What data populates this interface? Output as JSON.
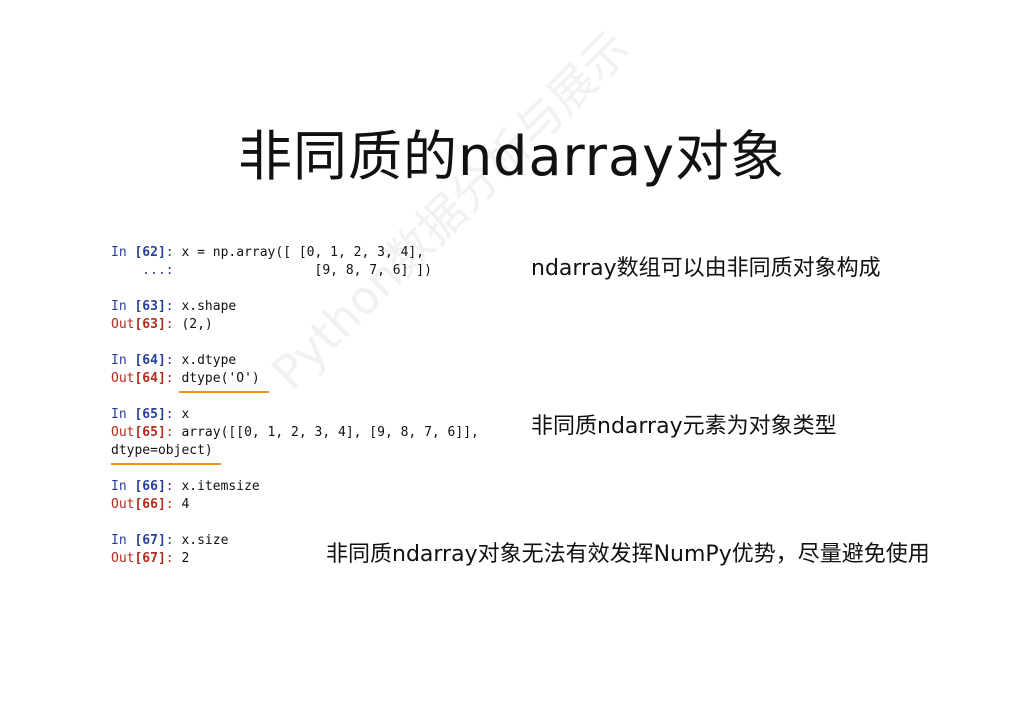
{
  "title": "非同质的ndarray对象",
  "watermark": "Python数据分析与展示",
  "cells": [
    {
      "in_prompt": "In ",
      "in_num": "[62]",
      "in_sep": ": ",
      "in_code": "x = np.array([ [0, 1, 2, 3, 4],",
      "cont_prompt": "    ...: ",
      "cont_code": "                 [9, 8, 7, 6] ])"
    },
    {
      "in_prompt": "In ",
      "in_num": "[63]",
      "in_sep": ": ",
      "in_code": "x.shape",
      "out_prompt": "Out",
      "out_num": "[63]",
      "out_sep": ": ",
      "out_code": "(2,)"
    },
    {
      "in_prompt": "In ",
      "in_num": "[64]",
      "in_sep": ": ",
      "in_code": "x.dtype",
      "out_prompt": "Out",
      "out_num": "[64]",
      "out_sep": ": ",
      "out_code": "dtype('O')"
    },
    {
      "in_prompt": "In ",
      "in_num": "[65]",
      "in_sep": ": ",
      "in_code": "x",
      "out_prompt": "Out",
      "out_num": "[65]",
      "out_sep": ": ",
      "out_code": "array([[0, 1, 2, 3, 4], [9, 8, 7, 6]],",
      "out_code2": "dtype=object)"
    },
    {
      "in_prompt": "In ",
      "in_num": "[66]",
      "in_sep": ": ",
      "in_code": "x.itemsize",
      "out_prompt": "Out",
      "out_num": "[66]",
      "out_sep": ": ",
      "out_code": "4"
    },
    {
      "in_prompt": "In ",
      "in_num": "[67]",
      "in_sep": ": ",
      "in_code": "x.size",
      "out_prompt": "Out",
      "out_num": "[67]",
      "out_sep": ": ",
      "out_code": "2"
    }
  ],
  "notes": {
    "note1": "ndarray数组可以由非同质对象构成",
    "note2": "非同质ndarray元素为对象类型",
    "note3": "非同质ndarray对象无法有效发挥NumPy优势，尽量避免使用"
  },
  "colors": {
    "in_prompt": "#2a3f9d",
    "out_prompt": "#b22b1c",
    "underline": "#f0901e"
  }
}
